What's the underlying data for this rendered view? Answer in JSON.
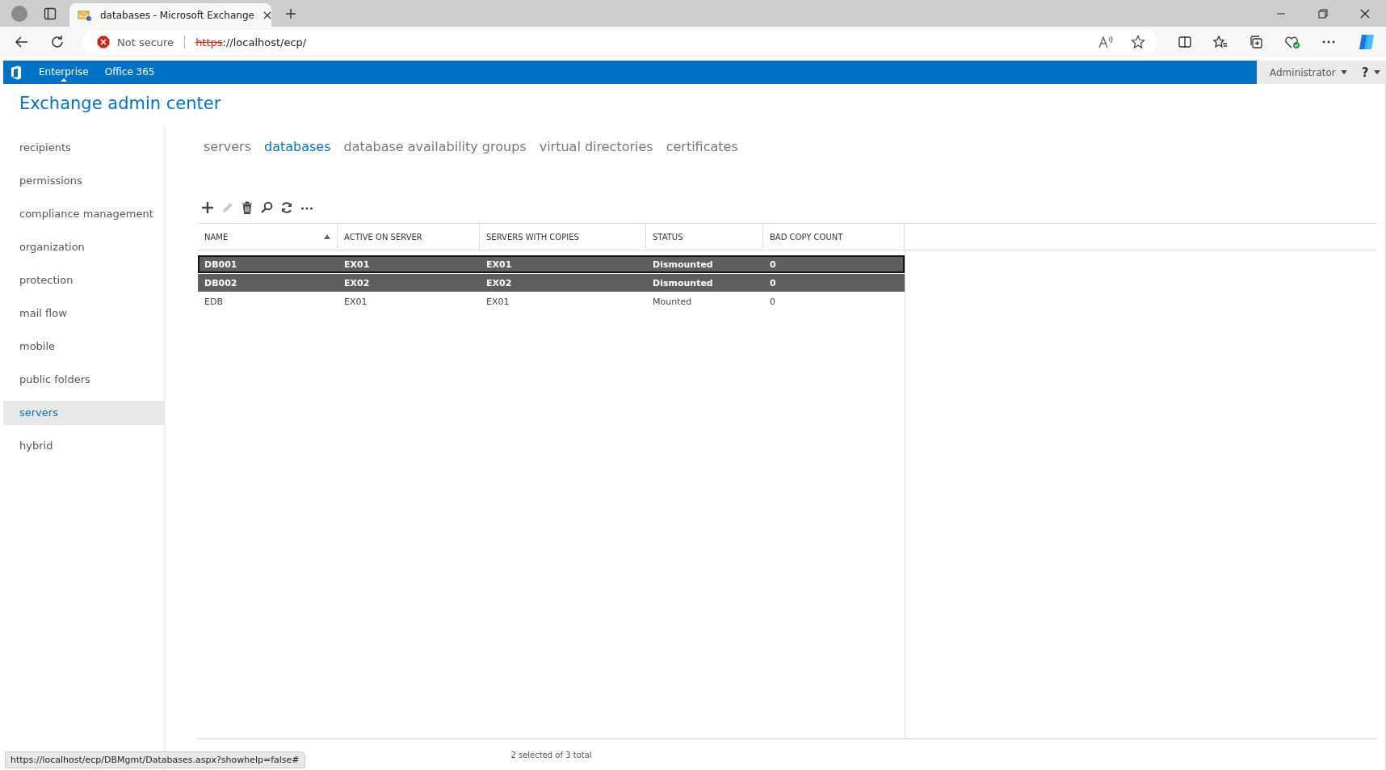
{
  "browser": {
    "tab_title": "databases - Microsoft Exchange",
    "security": "Not secure",
    "url_scheme": "https",
    "url_rest": "://localhost/ecp/",
    "status_url": "https://localhost/ecp/DBMgmt/Databases.aspx?showhelp=false#"
  },
  "top_nav": [
    {
      "label": "Enterprise",
      "selected": true
    },
    {
      "label": "Office 365",
      "selected": false
    }
  ],
  "user": "Administrator",
  "help": "?",
  "title": "Exchange admin center",
  "sidebar": {
    "items": [
      {
        "label": "recipients",
        "selected": false
      },
      {
        "label": "permissions",
        "selected": false
      },
      {
        "label": "compliance management",
        "selected": false
      },
      {
        "label": "organization",
        "selected": false
      },
      {
        "label": "protection",
        "selected": false
      },
      {
        "label": "mail flow",
        "selected": false
      },
      {
        "label": "mobile",
        "selected": false
      },
      {
        "label": "public folders",
        "selected": false
      },
      {
        "label": "servers",
        "selected": true
      },
      {
        "label": "hybrid",
        "selected": false
      }
    ]
  },
  "tabs": [
    {
      "label": "servers",
      "selected": false
    },
    {
      "label": "databases",
      "selected": true
    },
    {
      "label": "database availability groups",
      "selected": false
    },
    {
      "label": "virtual directories",
      "selected": false
    },
    {
      "label": "certificates",
      "selected": false
    }
  ],
  "toolbar": [
    {
      "kind": "add",
      "disabled": false
    },
    {
      "kind": "edit",
      "disabled": true
    },
    {
      "kind": "delete",
      "disabled": false
    },
    {
      "kind": "search",
      "disabled": false
    },
    {
      "kind": "refresh",
      "disabled": false
    },
    {
      "kind": "more",
      "disabled": false
    }
  ],
  "table": {
    "columns": [
      {
        "label": "NAME",
        "sorted": true
      },
      {
        "label": "ACTIVE ON SERVER",
        "sorted": false
      },
      {
        "label": "SERVERS WITH COPIES",
        "sorted": false
      },
      {
        "label": "STATUS",
        "sorted": false
      },
      {
        "label": "BAD COPY COUNT",
        "sorted": false
      }
    ],
    "rows": [
      {
        "cells": [
          "DB001",
          "EX01",
          "EX01",
          "Dismounted",
          "0"
        ],
        "selected": true
      },
      {
        "cells": [
          "DB002",
          "EX02",
          "EX02",
          "Dismounted",
          "0"
        ],
        "selected": true
      },
      {
        "cells": [
          "EDB",
          "EX01",
          "EX01",
          "Mounted",
          "0"
        ],
        "selected": false
      }
    ]
  },
  "footer": "2 selected of 3 total"
}
